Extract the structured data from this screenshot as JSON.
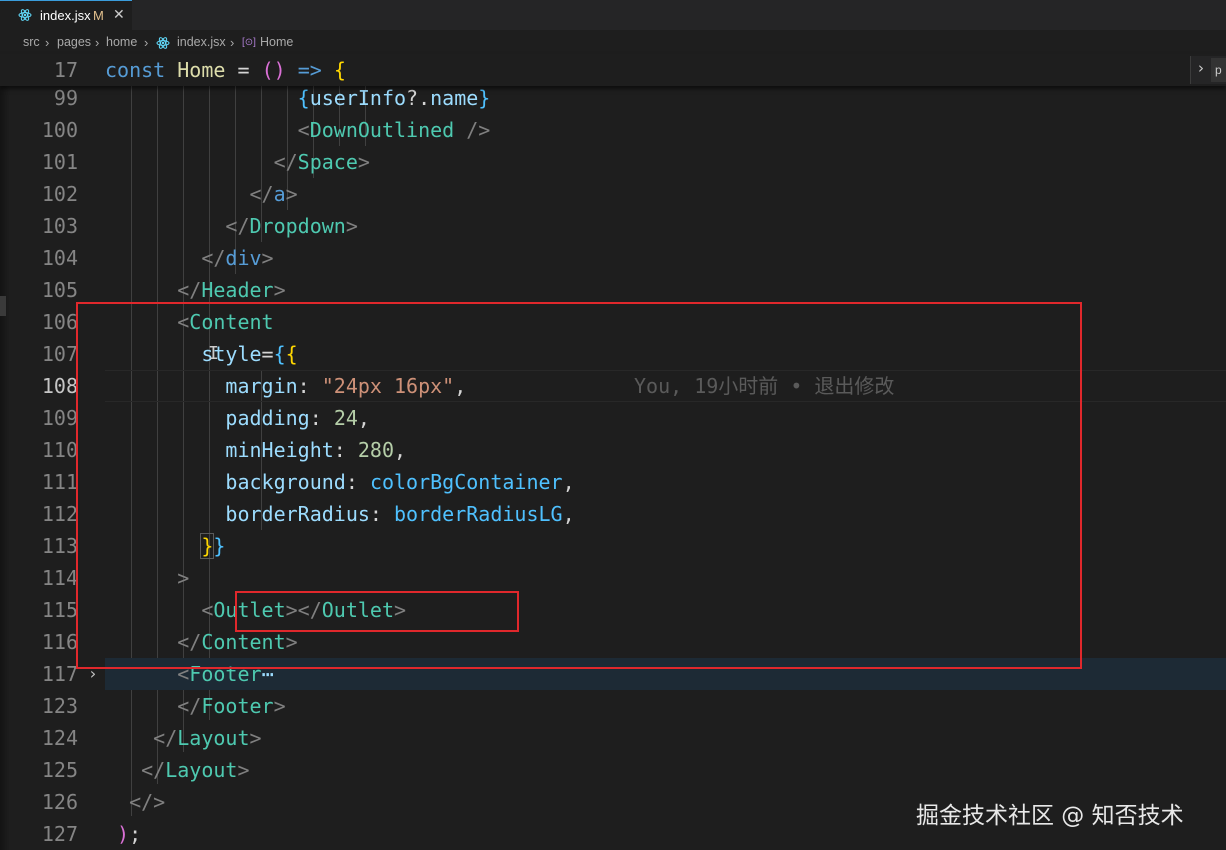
{
  "tab": {
    "icon": "react-icon",
    "file_name": "index.jsx",
    "modified_marker": "M",
    "close_symbol": "✕"
  },
  "breadcrumb": {
    "items": [
      "src",
      "pages",
      "home",
      "index.jsx",
      "Home"
    ],
    "sep": "›",
    "file_icon": "react-icon",
    "symbol_icon": "[⊙]"
  },
  "editor": {
    "sticky_line_number": "17",
    "sticky_code": {
      "kw": "const",
      "name": "Home",
      "eq": " = ",
      "paren": "()",
      "arrow": " => ",
      "brace": "{"
    },
    "line_numbers": [
      "99",
      "100",
      "101",
      "102",
      "103",
      "104",
      "105",
      "106",
      "107",
      "108",
      "109",
      "110",
      "111",
      "112",
      "113",
      "114",
      "115",
      "116",
      "117",
      "123",
      "124",
      "125",
      "126",
      "127"
    ],
    "active_line": "108",
    "blame": {
      "author": "You, 19小时前 • 退出修改"
    },
    "folded_placeholder": "⋯",
    "tokens": {
      "userInfo": "userInfo",
      "optional": "?.",
      "name": "name",
      "DownOutlined": "DownOutlined",
      "Space": "Space",
      "a": "a",
      "Dropdown": "Dropdown",
      "div": "div",
      "Header": "Header",
      "Content": "Content",
      "style": "style",
      "margin": "margin",
      "margin_val": "\"24px 16px\"",
      "padding": "padding",
      "padding_val": "24",
      "minHeight": "minHeight",
      "minHeight_val": "280",
      "background": "background",
      "background_val": "colorBgContainer",
      "borderRadius": "borderRadius",
      "borderRadius_val": "borderRadiusLG",
      "Outlet": "Outlet",
      "Footer": "Footer",
      "Layout": "Layout"
    }
  },
  "minimap_controls": {
    "chevron": "›",
    "label": "p"
  },
  "watermark": "掘金技术社区 @ 知否技术",
  "colors": {
    "highlight_box": "#e0282c",
    "background": "#1e1e1e",
    "tag": "#4ec9b0",
    "attr": "#9cdcfe",
    "string": "#ce9178",
    "number": "#b5cea8"
  }
}
